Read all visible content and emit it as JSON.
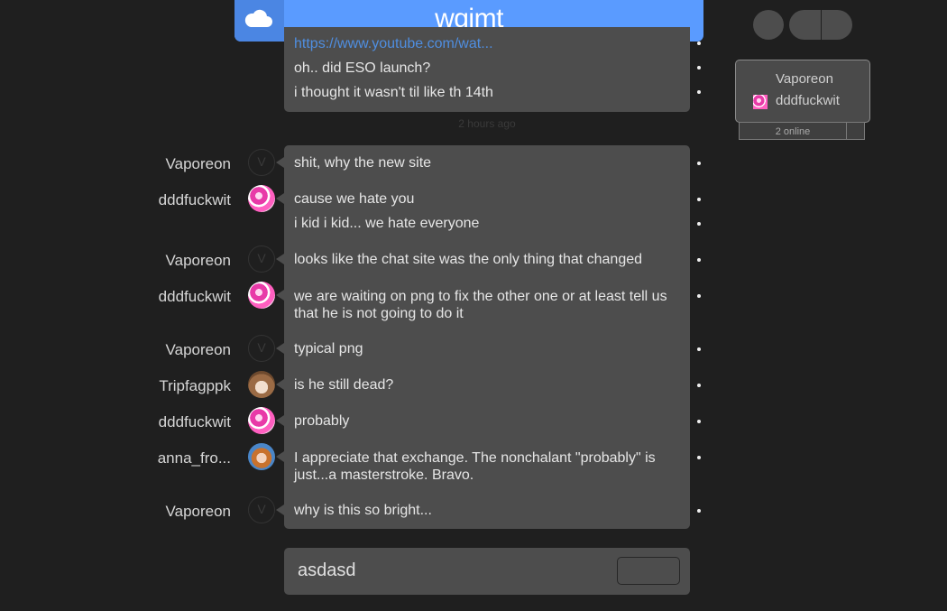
{
  "header": {
    "title": "wgimt",
    "icon": "cloud-icon"
  },
  "top_messages": [
    "https://www.youtube.com/wat...",
    "oh.. did ESO launch?",
    "i thought it wasn't til like th 14th"
  ],
  "time_separator": "2 hours ago",
  "groups": [
    {
      "user": "Vaporeon",
      "avatar": "V",
      "messages": [
        "shit, why the new site"
      ]
    },
    {
      "user": "dddfuckwit",
      "avatar": "",
      "messages": [
        "cause we hate you",
        "i kid i kid... we hate everyone"
      ]
    },
    {
      "user": "Vaporeon",
      "avatar": "V",
      "messages": [
        "looks like the chat site was the only thing that changed"
      ]
    },
    {
      "user": "dddfuckwit",
      "avatar": "",
      "messages": [
        "we are waiting on png to fix the other one or at least tell us that he is not going to do it"
      ]
    },
    {
      "user": "Vaporeon",
      "avatar": "V",
      "messages": [
        "typical png"
      ]
    },
    {
      "user": "Tripfagppk",
      "avatar": "",
      "messages": [
        "is he still dead?"
      ]
    },
    {
      "user": "dddfuckwit",
      "avatar": "",
      "messages": [
        "probably"
      ]
    },
    {
      "user": "anna_fro...",
      "avatar": "",
      "messages": [
        "I appreciate that exchange. The nonchalant \"probably\" is just...a masterstroke. Bravo."
      ]
    },
    {
      "user": "Vaporeon",
      "avatar": "V",
      "messages": [
        "why is this so bright..."
      ]
    }
  ],
  "online": {
    "users": [
      "Vaporeon",
      "dddfuckwit"
    ],
    "count_label": "2 online"
  },
  "composer": {
    "value": "asdasd"
  }
}
